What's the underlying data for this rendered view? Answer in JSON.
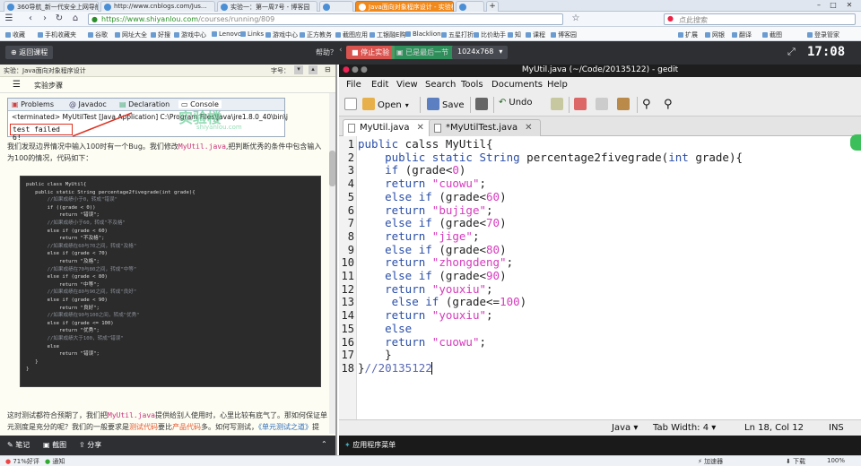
{
  "browser": {
    "tabs": [
      {
        "label": "360导航_新一代安全上网导航",
        "active": false
      },
      {
        "label": "http://www.cnblogs.com/Jus...",
        "active": false
      },
      {
        "label": "实验一：第一周7号 - 博客园",
        "active": false
      },
      {
        "label": "",
        "active": false
      },
      {
        "label": "Java面向对象程序设计 - 实验楼",
        "active": true
      },
      {
        "label": "",
        "active": false
      }
    ],
    "url_host": "https://www.shiyanlou.com",
    "url_path": "/courses/running/809",
    "search_placeholder": "点此搜索",
    "bookmarks": [
      "收藏",
      "手机收藏夹",
      "谷歌",
      "网址大全",
      "好搜",
      "游戏中心",
      "Lenovo",
      "Links",
      "游戏中心",
      "正方教务",
      "截图应用",
      "工银融E购",
      "Blacklion",
      "五星打折",
      "比价助手",
      "知",
      "课程",
      "博客园",
      "扩展",
      "网银",
      "翻译",
      "截图",
      "登录管家"
    ]
  },
  "lab_toolbar": {
    "back_label": "返回课程",
    "help_label": "帮助？",
    "stop_label": "停止实验",
    "save_label": "已是最后一节",
    "resolution_label": "1024x768",
    "timer": "17:08"
  },
  "left_panel": {
    "header_title": "实验：Java面向对象程序设计",
    "font_label": "字号：",
    "steps_label": "实验步骤",
    "eclipse_tabs": [
      "Problems",
      "Javadoc",
      "Declaration",
      "Console"
    ],
    "eclipse_terminated": "<terminated> MyUtilTest [Java Application] C:\\Program Files\\Java\\jre1.8.0_40\\bin\\j",
    "eclipse_output": "test failed 6!",
    "watermark": "实验楼",
    "watermark_sub": "shiyanlou.com",
    "para1_a": "我们发现边界情况中输入100时有一个Bug。我们修改",
    "para1_file": "MyUtil.java",
    "para1_b": ",把判断优秀的条件中包含输入为100的情况，代码如下：",
    "code_image_lines": [
      "public class MyUtil{",
      "   public static String percentage2fivegrade(int grade){",
      "       //如果成绩小于0，转成\"错误\"",
      "       if ((grade < 0))",
      "           return \"错误\";",
      "       //如果成绩小于60，转成\"不及格\"",
      "       else if (grade < 60)",
      "           return \"不及格\";",
      "       //如果成绩在60与70之间，转成\"及格\"",
      "       else if (grade < 70)",
      "           return \"及格\";",
      "       //如果成绩在70与80之间，转成\"中等\"",
      "       else if (grade < 80)",
      "           return \"中等\";",
      "       //如果成绩在80与90之间，转成\"良好\"",
      "       else if (grade < 90)",
      "           return \"良好\";",
      "       //如果成绩在90与100之间，转成\"优秀\"",
      "       else if (grade <= 100)",
      "           return \"优秀\";",
      "       //如果成绩大于100，转成\"错误\"",
      "       else",
      "           return \"错误\";",
      "   }",
      "}"
    ],
    "para2_a": "这时测试都符合预期了，我们把",
    "para2_file": "MyUtil.java",
    "para2_b": "提供给别人使用时，心里比较有底气了。那如何保证单",
    "para3_a": "元测度是充分的呢？我们的一般要求是",
    "para3_red1": "测试代码",
    "para3_b": "要比",
    "para3_red2": "产品代码",
    "para3_c": "多。如何写测试，",
    "para3_link": "《单元测试之道》",
    "para3_d": "提",
    "bottom_notes": "笔记",
    "bottom_screenshot": "截图",
    "bottom_share": "分享"
  },
  "gedit": {
    "title": "MyUtil.java (~/Code/20135122) - gedit",
    "menu": [
      "File",
      "Edit",
      "View",
      "Search",
      "Tools",
      "Documents",
      "Help"
    ],
    "toolbar": {
      "open": "Open",
      "save": "Save",
      "undo": "Undo"
    },
    "tabs": [
      {
        "label": "MyUtil.java",
        "active": true
      },
      {
        "label": "*MyUtilTest.java",
        "active": false
      }
    ],
    "line_numbers": [
      "1",
      "2",
      "3",
      "4",
      "5",
      "6",
      "7",
      "8",
      "9",
      "10",
      "11",
      "12",
      "13",
      "14",
      "15",
      "16",
      "17",
      "18"
    ],
    "code": {
      "l1": {
        "kw": "public",
        "rest": " calss MyUtil{"
      },
      "l2": {
        "kw": "public static",
        "t": "String",
        "fn": " percentage2fivegrade(",
        "t2": "int",
        "rest": " grade){"
      },
      "l3": {
        "kw": "if",
        "a": " (grade<",
        "n": "0",
        "b": ")"
      },
      "l4": {
        "kw": "return",
        "s": "\"cuowu\"",
        "b": ";"
      },
      "l5": {
        "kw": "else if",
        "a": " (grade<",
        "n": "60",
        "b": ")"
      },
      "l6": {
        "kw": "return",
        "s": "\"bujige\"",
        "b": ";"
      },
      "l7": {
        "kw": "else if",
        "a": " (grade<",
        "n": "70",
        "b": ")"
      },
      "l8": {
        "kw": "return",
        "s": "\"jige\"",
        "b": ";"
      },
      "l9": {
        "kw": "else if",
        "a": " (grade<",
        "n": "80",
        "b": ")"
      },
      "l10": {
        "kw": "return",
        "s": "\"zhongdeng\"",
        "b": ";"
      },
      "l11": {
        "kw": "else if",
        "a": " (grade<",
        "n": "90",
        "b": ")"
      },
      "l12": {
        "kw": "return",
        "s": "\"youxiu\"",
        "b": ";"
      },
      "l13": {
        "kw": "else if",
        "a": " (grade<=",
        "n": "100",
        "b": ")"
      },
      "l14": {
        "kw": "return",
        "s": "\"youxiu\"",
        "b": ";"
      },
      "l15": {
        "kw": "else"
      },
      "l16": {
        "kw": "return",
        "s": "\"cuowu\"",
        "b": ";"
      },
      "l17": {
        "b": "}"
      },
      "l18": {
        "b": "}",
        "c": "//20135122"
      }
    },
    "status": {
      "language": "Java",
      "tab_width": "Tab Width: 4",
      "position": "Ln 18, Col 12",
      "mode": "INS"
    },
    "taskbar_label": "应用程序菜单"
  },
  "statusbar": {
    "zoom_left": "71%好评",
    "notice": "通知",
    "speed": "下载",
    "accel": "加速器",
    "download": "下载",
    "zoom": "100%"
  },
  "colors": {
    "accent_orange": "#f18a1d",
    "stop_red": "#d9534f",
    "save_green": "#2fa866",
    "keyword_blue": "#2a4ea8",
    "string_magenta": "#d63abd"
  }
}
